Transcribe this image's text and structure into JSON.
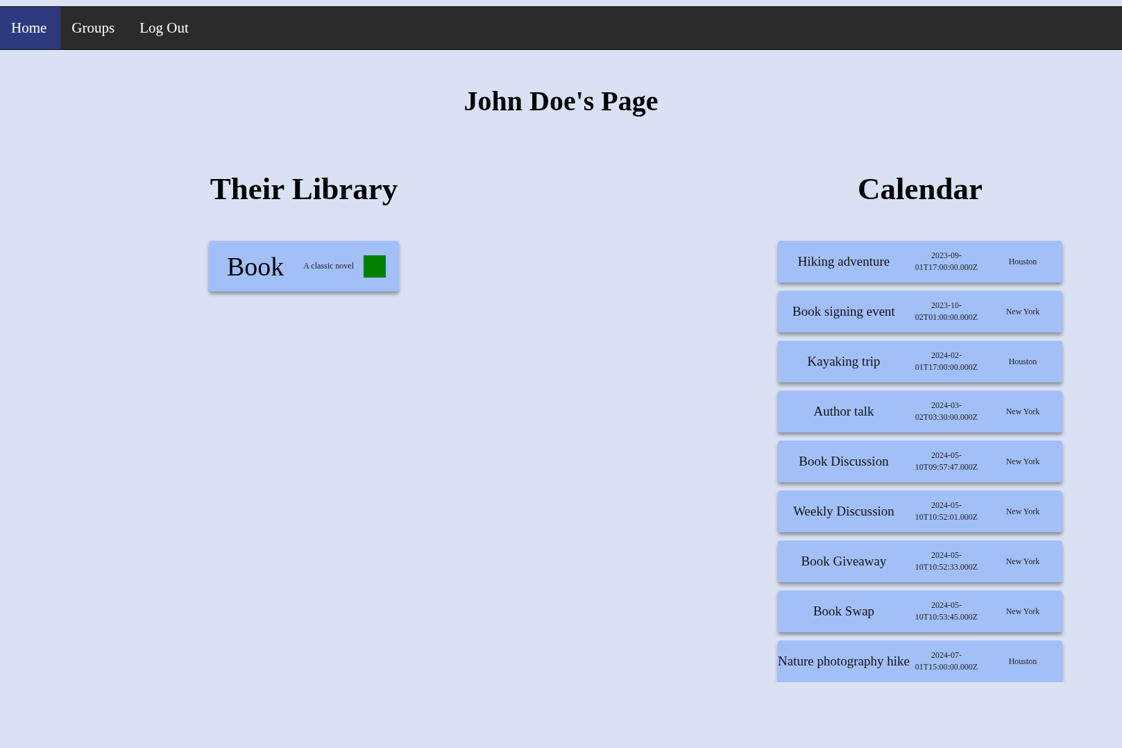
{
  "nav": [
    {
      "label": "Home",
      "selected": true
    },
    {
      "label": "Groups",
      "selected": false
    },
    {
      "label": "Log Out",
      "selected": false
    }
  ],
  "page_title": "John Doe's Page",
  "library": {
    "heading": "Their Library",
    "books": [
      {
        "title": "Book",
        "description": "A classic novel",
        "color": "#008000"
      }
    ]
  },
  "calendar": {
    "heading": "Calendar",
    "events": [
      {
        "name": "Hiking adventure",
        "date": "2023-09-01T17:00:00.000Z",
        "location": "Houston"
      },
      {
        "name": "Book signing event",
        "date": "2023-10-02T01:00:00.000Z",
        "location": "New York"
      },
      {
        "name": "Kayaking trip",
        "date": "2024-02-01T17:00:00.000Z",
        "location": "Houston"
      },
      {
        "name": "Author talk",
        "date": "2024-03-02T03:30:00.000Z",
        "location": "New York"
      },
      {
        "name": "Book Discussion",
        "date": "2024-05-10T09:57:47.000Z",
        "location": "New York"
      },
      {
        "name": "Weekly Discussion",
        "date": "2024-05-10T10:52:01.000Z",
        "location": "New York"
      },
      {
        "name": "Book Giveaway",
        "date": "2024-05-10T10:52:33.000Z",
        "location": "New York"
      },
      {
        "name": "Book Swap",
        "date": "2024-05-10T10:53:45.000Z",
        "location": "New York"
      },
      {
        "name": "Nature photography hike",
        "date": "2024-07-01T15:00:00.000Z",
        "location": "Houston"
      }
    ]
  }
}
